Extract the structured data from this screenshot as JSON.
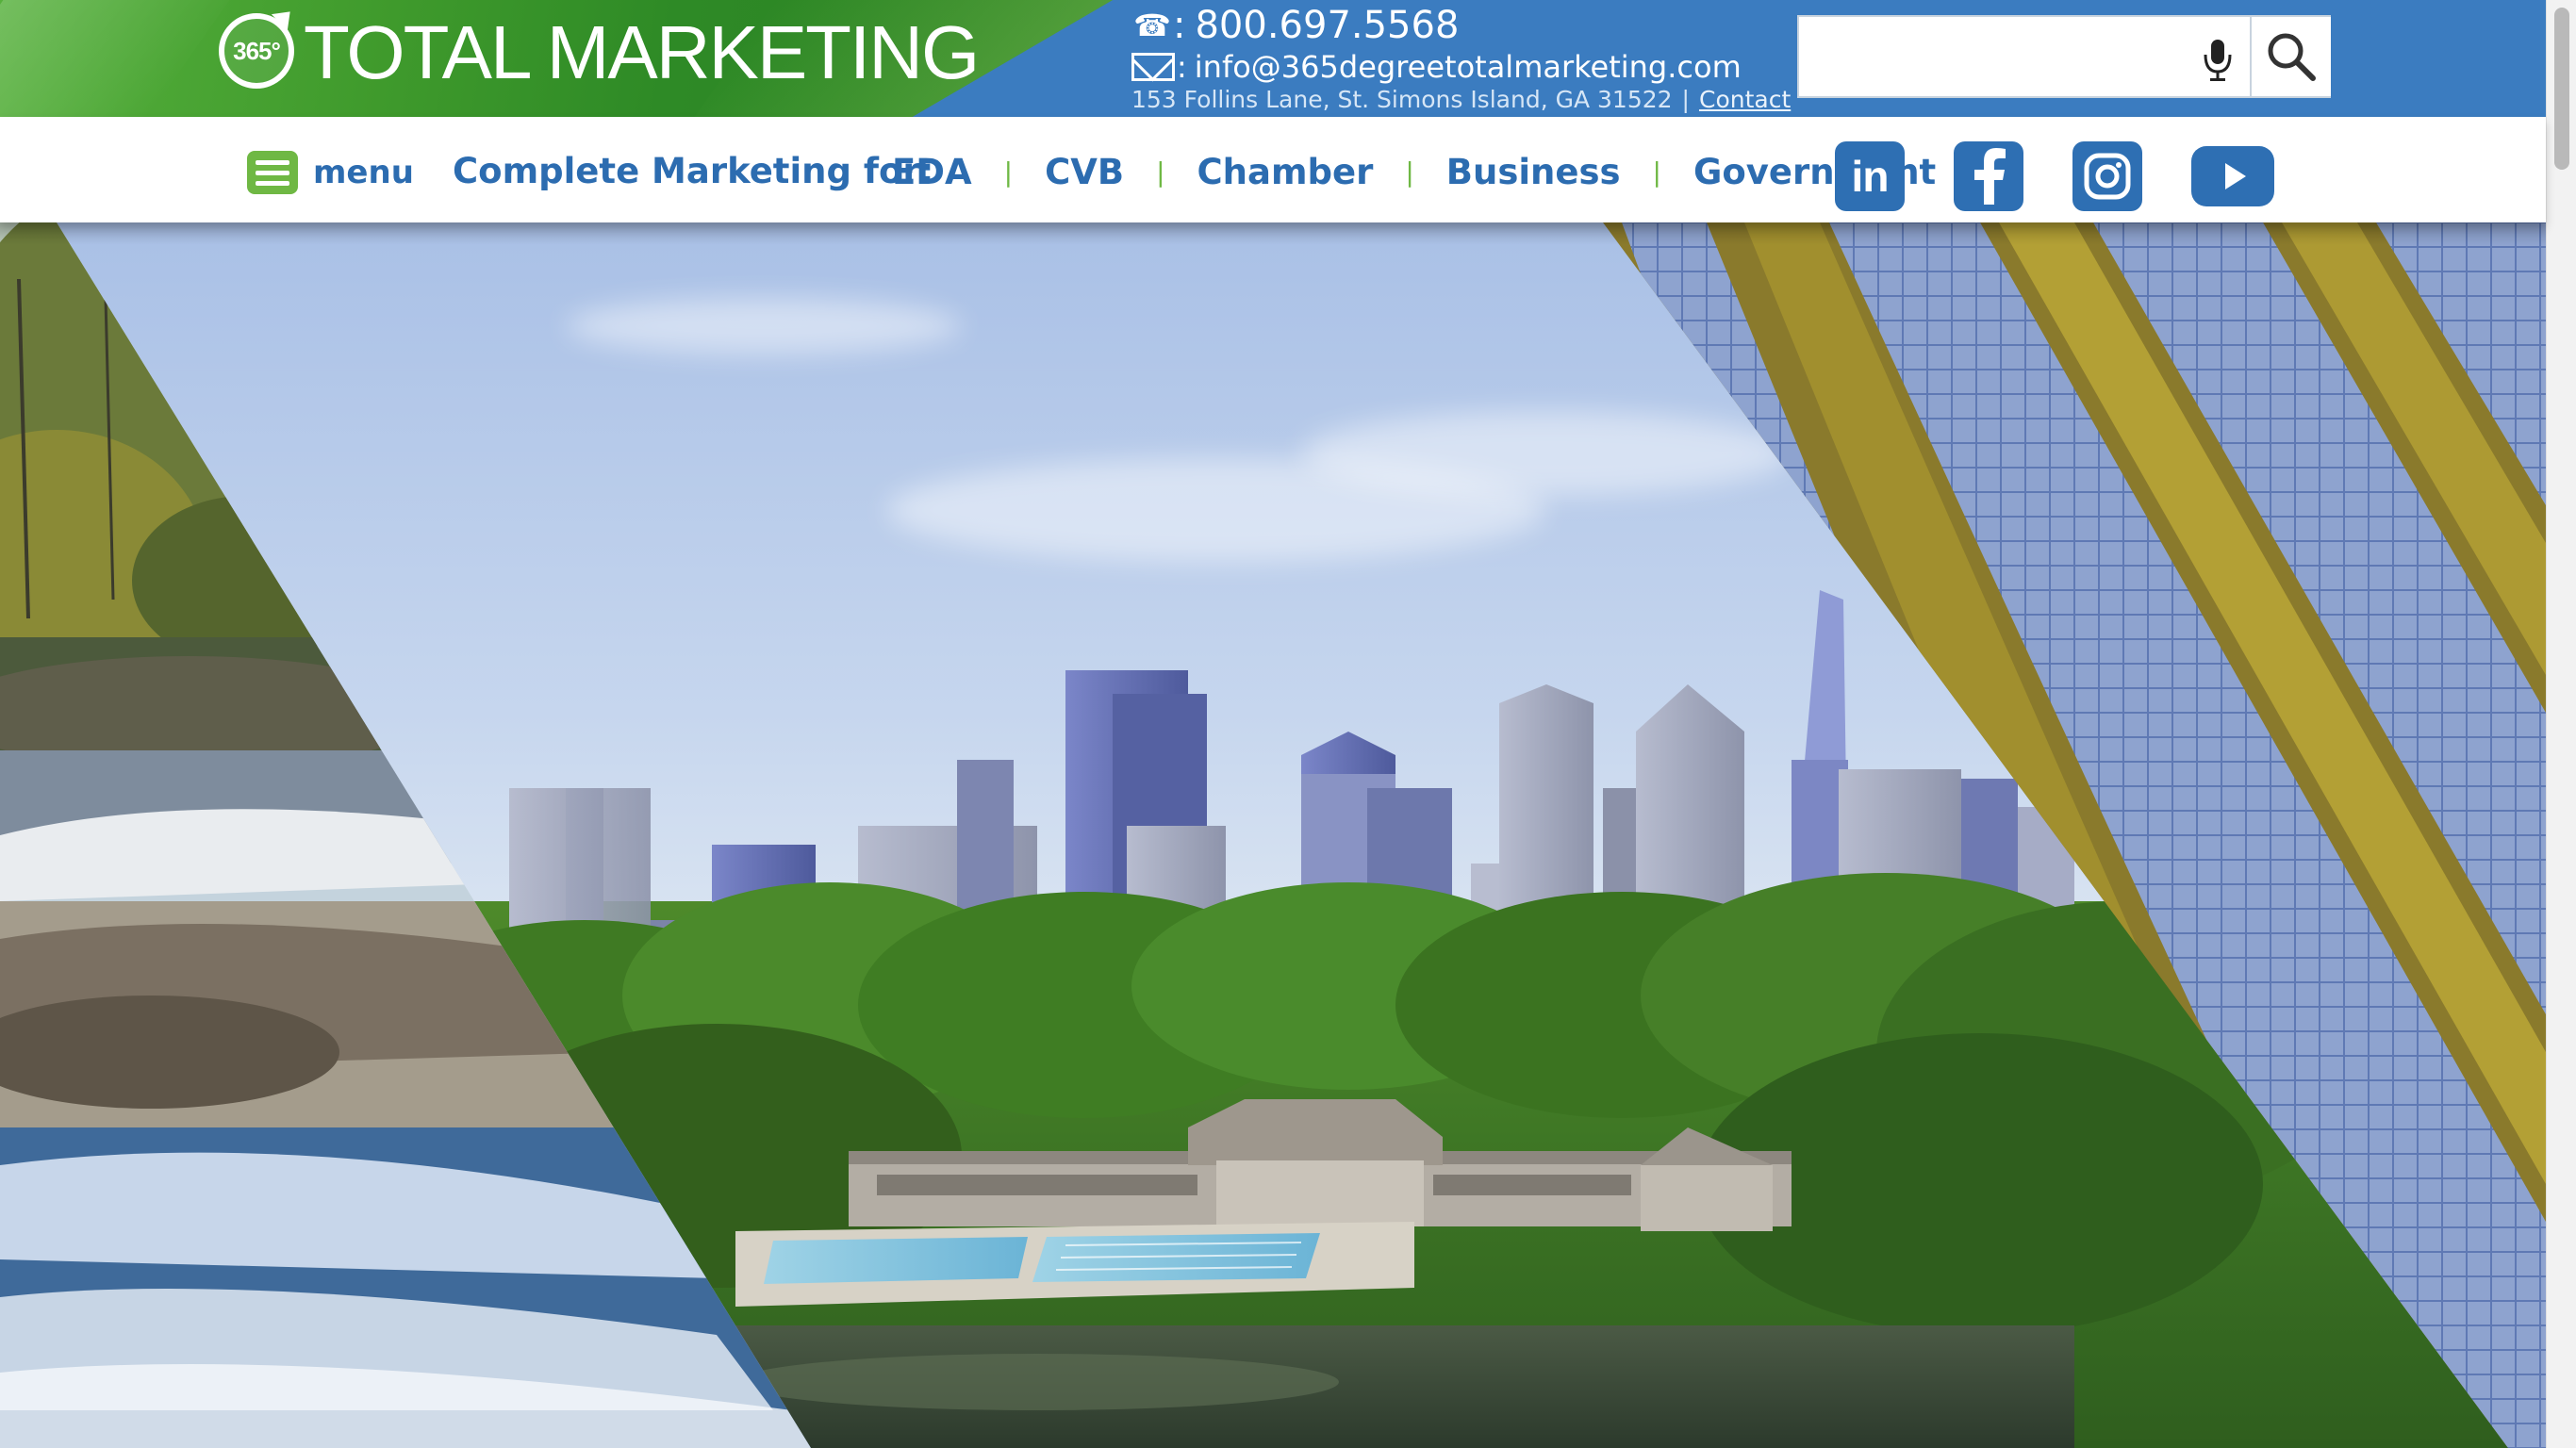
{
  "brand": {
    "logo_badge": "365°",
    "logo_text": "TOTAL MARKETING",
    "green": "#4fa83a",
    "blue": "#3b7cc0",
    "link_blue": "#2c6cb0"
  },
  "contact": {
    "phone_prefix": ":",
    "phone": "800.697.5568",
    "email_prefix": ":",
    "email": "info@365degreetotalmarketing.com",
    "address": "153 Follins Lane, St. Simons Island, GA 31522",
    "separator": "|",
    "contact_link": "Contact"
  },
  "search": {
    "placeholder": "",
    "value": ""
  },
  "nav": {
    "menu_label": "menu",
    "complete_label": "Complete Marketing for:",
    "links": [
      "EDA",
      "CVB",
      "Chamber",
      "Business",
      "Government"
    ],
    "separator": "|"
  },
  "social": {
    "linkedin": "in",
    "items": [
      "linkedin-icon",
      "facebook-icon",
      "instagram-icon",
      "youtube-icon"
    ]
  },
  "hero": {
    "description_icon": "hero-image"
  }
}
